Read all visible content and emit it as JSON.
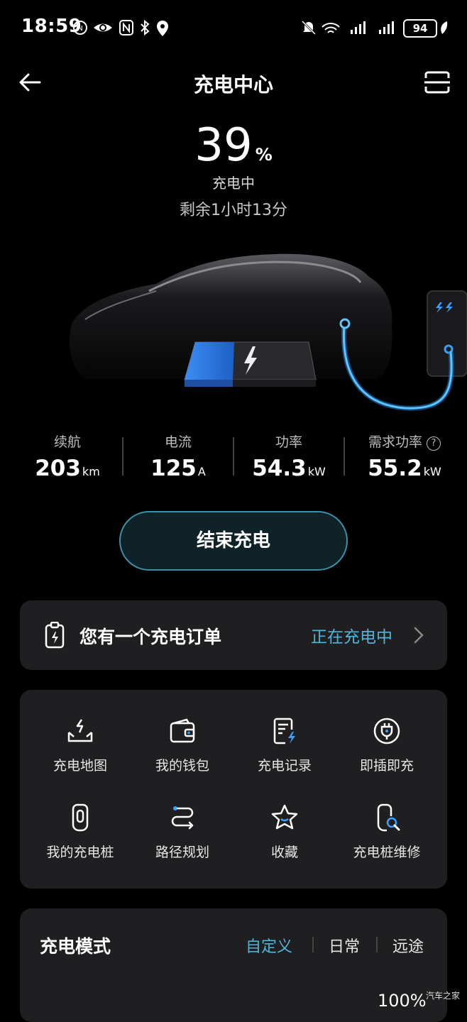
{
  "status_bar": {
    "time": "18:59",
    "battery": "94",
    "left_icons": [
      "n-icon",
      "eye-icon",
      "nfc-icon",
      "bluetooth-icon",
      "location-icon"
    ],
    "right_icons": [
      "mute-icon",
      "wifi-icon",
      "signal-icon",
      "signal-icon",
      "battery-icon",
      "leaf-icon"
    ]
  },
  "header": {
    "title": "充电中心",
    "back_icon": "back-arrow-icon",
    "scan_icon": "scan-icon"
  },
  "charge": {
    "percent": "39",
    "percent_sign": "%",
    "status": "充电中",
    "remaining": "剩余1小时13分"
  },
  "stats": [
    {
      "label": "续航",
      "value": "203",
      "unit": "km"
    },
    {
      "label": "电流",
      "value": "125",
      "unit": "A"
    },
    {
      "label": "功率",
      "value": "54.3",
      "unit": "kW"
    },
    {
      "label": "需求功率",
      "value": "55.2",
      "unit": "kW"
    }
  ],
  "end_button": "结束充电",
  "order": {
    "text": "您有一个充电订单",
    "status": "正在充电中"
  },
  "grid": [
    {
      "label": "充电地图",
      "icon": "charging-map-icon"
    },
    {
      "label": "我的钱包",
      "icon": "wallet-icon"
    },
    {
      "label": "充电记录",
      "icon": "charging-record-icon"
    },
    {
      "label": "即插即充",
      "icon": "plug-and-charge-icon"
    },
    {
      "label": "我的充电桩",
      "icon": "charging-pile-icon"
    },
    {
      "label": "路径规划",
      "icon": "route-icon"
    },
    {
      "label": "收藏",
      "icon": "star-icon"
    },
    {
      "label": "充电桩维修",
      "icon": "repair-icon"
    }
  ],
  "mode": {
    "title": "充电模式",
    "tabs": [
      "自定义",
      "日常",
      "远途"
    ],
    "active_tab": 0,
    "value": "100%"
  },
  "watermark": "汽车之家",
  "colors": {
    "accent": "#4fb4d8",
    "battery_fill": "#2f7de8",
    "card": "#1f1f21"
  }
}
